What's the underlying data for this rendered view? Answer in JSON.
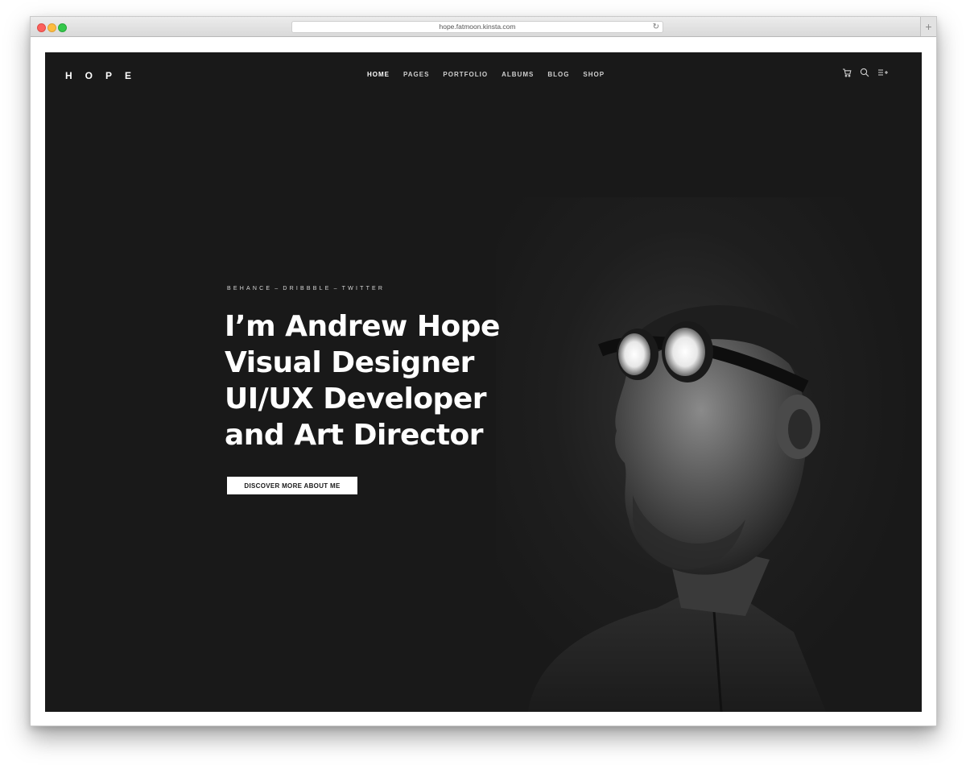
{
  "browser": {
    "url": "hope.fatmoon.kinsta.com",
    "reload_glyph": "↻",
    "newtab_glyph": "+"
  },
  "site": {
    "logo": "HOPE",
    "nav": [
      {
        "label": "HOME",
        "active": true
      },
      {
        "label": "PAGES"
      },
      {
        "label": "PORTFOLIO"
      },
      {
        "label": "ALBUMS"
      },
      {
        "label": "BLOG"
      },
      {
        "label": "SHOP"
      }
    ],
    "icons": [
      "cart-icon",
      "search-icon",
      "menu-icon"
    ]
  },
  "hero": {
    "socials": [
      "BEHANCE",
      "DRIBBBLE",
      "TWITTER"
    ],
    "separator": "–",
    "headline": [
      "I’m Andrew Hope",
      "Visual Designer",
      "UI/UX Developer",
      "and Art Director"
    ],
    "cta": "DISCOVER MORE ABOUT ME"
  },
  "colors": {
    "background": "#191919",
    "text": "#ffffff",
    "button_bg": "#ffffff",
    "button_text": "#1a1a1a"
  }
}
